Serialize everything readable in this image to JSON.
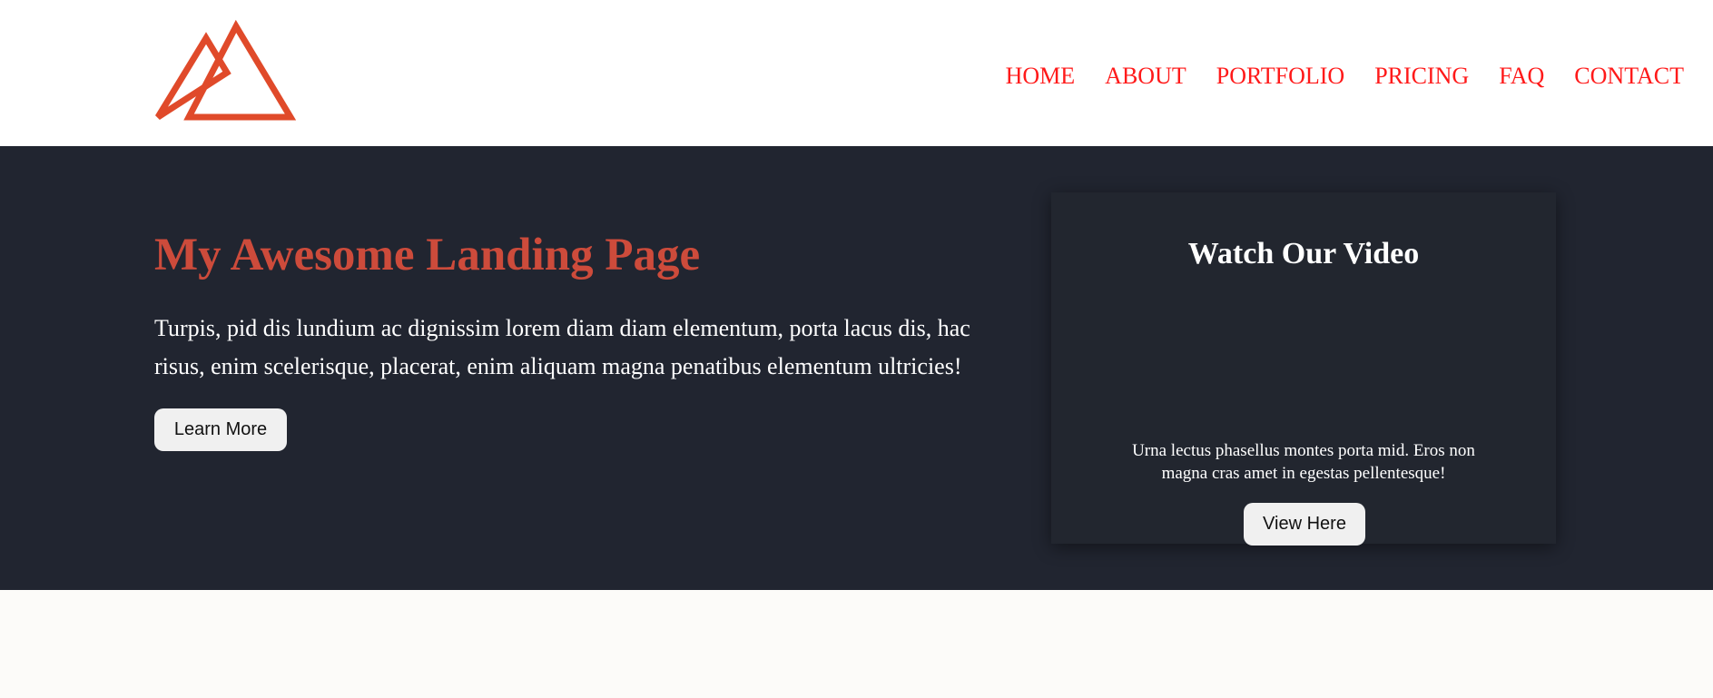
{
  "nav": {
    "items": [
      {
        "label": "HOME"
      },
      {
        "label": "ABOUT"
      },
      {
        "label": "PORTFOLIO"
      },
      {
        "label": "PRICING"
      },
      {
        "label": "FAQ"
      },
      {
        "label": "CONTACT"
      }
    ]
  },
  "logo": {
    "icon": "mountain-logo-icon",
    "color": "#e04a2a"
  },
  "hero": {
    "title": "My Awesome Landing Page",
    "text": "Turpis, pid dis lundium ac dignissim lorem diam diam elementum, porta lacus dis, hac risus, enim scelerisque, placerat, enim aliquam magna penatibus elementum ultricies!",
    "button_label": "Learn More"
  },
  "video_card": {
    "title": "Watch Our Video",
    "text": "Urna lectus phasellus montes porta mid. Eros non magna cras amet in egestas pellentesque!",
    "button_label": "View Here"
  },
  "colors": {
    "nav_link": "#ff1a1a",
    "title_accent": "#cd4b3b",
    "hero_bg": "#212530",
    "page_bg": "#fcfbf9"
  }
}
